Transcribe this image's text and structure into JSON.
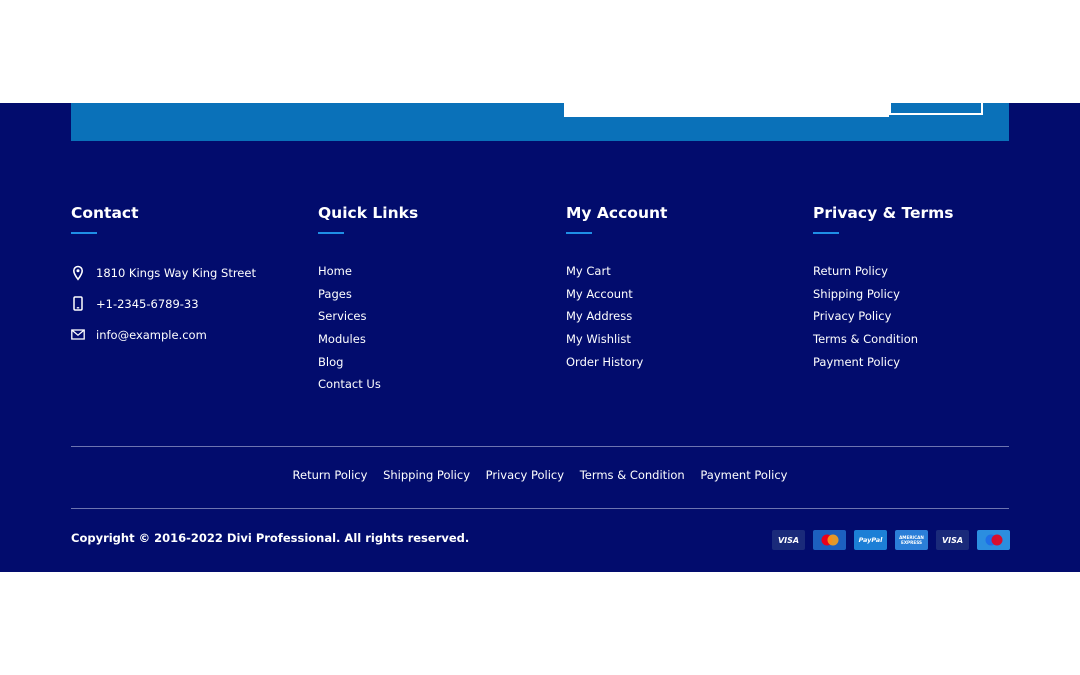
{
  "newsletter": {
    "input_placeholder": "",
    "button_label": ""
  },
  "columns": {
    "contact": {
      "title": "Contact",
      "items": [
        {
          "icon": "map-pin-icon",
          "text": "1810 Kings Way King Street"
        },
        {
          "icon": "phone-icon",
          "text": "+1-2345-6789-33"
        },
        {
          "icon": "envelope-icon",
          "text": "info@example.com"
        }
      ]
    },
    "quick_links": {
      "title": "Quick Links",
      "items": [
        "Home",
        "Pages",
        "Services",
        "Modules",
        "Blog",
        "Contact Us"
      ]
    },
    "my_account": {
      "title": "My Account",
      "items": [
        "My Cart",
        "My Account",
        "My Address",
        "My Wishlist",
        "Order History"
      ]
    },
    "privacy_terms": {
      "title": "Privacy & Terms",
      "items": [
        "Return Policy",
        "Shipping Policy",
        "Privacy Policy",
        "Terms & Condition",
        "Payment Policy"
      ]
    }
  },
  "bottom_links": [
    "Return Policy",
    "Shipping Policy",
    "Privacy Policy",
    "Terms & Condition",
    "Payment Policy"
  ],
  "copyright": "Copyright © 2016-2022 Divi Professional. All rights reserved.",
  "payment_methods": [
    {
      "name": "visa-icon",
      "label": "VISA",
      "bg": "#1a2a7a"
    },
    {
      "name": "mastercard-icon",
      "label": "",
      "bg": "#1c5fbf"
    },
    {
      "name": "paypal-icon",
      "label": "PayPal",
      "bg": "#1c7fd6"
    },
    {
      "name": "american-express-icon",
      "label": "AMERICAN EXPRESS",
      "bg": "#2b7ed8"
    },
    {
      "name": "visa-icon",
      "label": "VISA",
      "bg": "#1a2a7a"
    },
    {
      "name": "maestro-icon",
      "label": "",
      "bg": "#2b8ee0"
    }
  ],
  "colors": {
    "footer_bg": "#020c6d",
    "accent_band": "#0a71b9",
    "heading_underline": "#1f8fe6"
  }
}
